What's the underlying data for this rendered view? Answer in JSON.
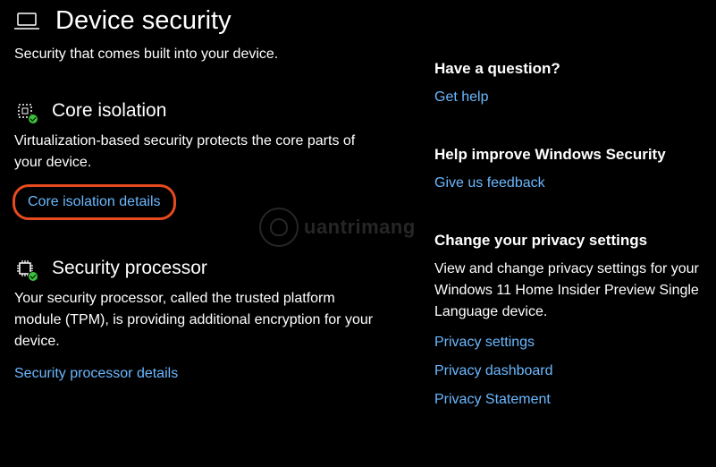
{
  "header": {
    "title": "Device security",
    "subtitle": "Security that comes built into your device."
  },
  "sections": {
    "coreIsolation": {
      "title": "Core isolation",
      "description": "Virtualization-based security protects the core parts of your device.",
      "link": "Core isolation details"
    },
    "securityProcessor": {
      "title": "Security processor",
      "description": "Your security processor, called the trusted platform module (TPM), is providing additional encryption for your device.",
      "link": "Security processor details"
    }
  },
  "sidebar": {
    "question": {
      "title": "Have a question?",
      "link": "Get help"
    },
    "improve": {
      "title": "Help improve Windows Security",
      "link": "Give us feedback"
    },
    "privacy": {
      "title": "Change your privacy settings",
      "description": "View and change privacy settings for your Windows 11 Home Insider Preview Single Language device.",
      "links": [
        "Privacy settings",
        "Privacy dashboard",
        "Privacy Statement"
      ]
    }
  },
  "watermark": "uantrimang"
}
